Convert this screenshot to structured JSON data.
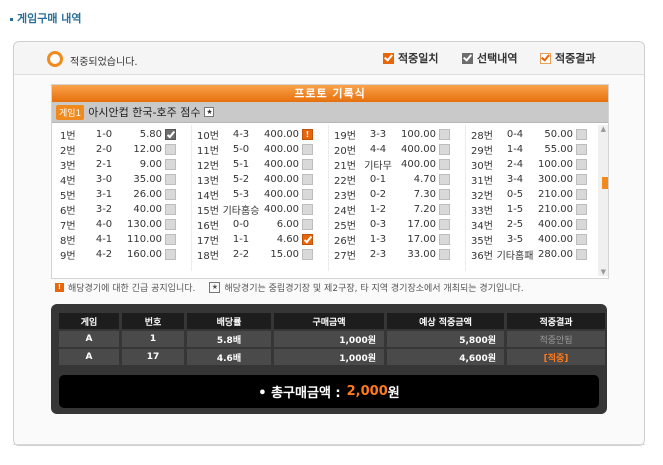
{
  "page": {
    "title": "게임구매 내역"
  },
  "status": {
    "text": "적중되었습니다."
  },
  "legend": [
    {
      "label": "적중일치",
      "style": "orange"
    },
    {
      "label": "선택내역",
      "style": "gray"
    },
    {
      "label": "적중결과",
      "style": "outline"
    }
  ],
  "proto": {
    "title": "프로토 기록식",
    "game_tag": "게임1",
    "game_name": "아시안컵 한국-호주 점수",
    "info_icon": "★"
  },
  "columns": [
    {
      "rows": [
        {
          "no": "1번",
          "res": "1-0",
          "odd": "5.80",
          "mark": "gray"
        },
        {
          "no": "2번",
          "res": "2-0",
          "odd": "12.00",
          "mark": ""
        },
        {
          "no": "3번",
          "res": "2-1",
          "odd": "9.00",
          "mark": ""
        },
        {
          "no": "4번",
          "res": "3-0",
          "odd": "35.00",
          "mark": ""
        },
        {
          "no": "5번",
          "res": "3-1",
          "odd": "26.00",
          "mark": ""
        },
        {
          "no": "6번",
          "res": "3-2",
          "odd": "40.00",
          "mark": ""
        },
        {
          "no": "7번",
          "res": "4-0",
          "odd": "130.00",
          "mark": ""
        },
        {
          "no": "8번",
          "res": "4-1",
          "odd": "110.00",
          "mark": ""
        },
        {
          "no": "9번",
          "res": "4-2",
          "odd": "160.00",
          "mark": ""
        }
      ]
    },
    {
      "rows": [
        {
          "no": "10번",
          "res": "4-3",
          "odd": "400.00",
          "mark": "excl"
        },
        {
          "no": "11번",
          "res": "5-0",
          "odd": "400.00",
          "mark": ""
        },
        {
          "no": "12번",
          "res": "5-1",
          "odd": "400.00",
          "mark": ""
        },
        {
          "no": "13번",
          "res": "5-2",
          "odd": "400.00",
          "mark": ""
        },
        {
          "no": "14번",
          "res": "5-3",
          "odd": "400.00",
          "mark": ""
        },
        {
          "no": "15번",
          "res": "기타홈승",
          "odd": "400.00",
          "mark": ""
        },
        {
          "no": "16번",
          "res": "0-0",
          "odd": "6.00",
          "mark": ""
        },
        {
          "no": "17번",
          "res": "1-1",
          "odd": "4.60",
          "mark": "orange"
        },
        {
          "no": "18번",
          "res": "2-2",
          "odd": "15.00",
          "mark": ""
        }
      ]
    },
    {
      "rows": [
        {
          "no": "19번",
          "res": "3-3",
          "odd": "100.00",
          "mark": ""
        },
        {
          "no": "20번",
          "res": "4-4",
          "odd": "400.00",
          "mark": ""
        },
        {
          "no": "21번",
          "res": "기타무",
          "odd": "400.00",
          "mark": ""
        },
        {
          "no": "22번",
          "res": "0-1",
          "odd": "4.70",
          "mark": ""
        },
        {
          "no": "23번",
          "res": "0-2",
          "odd": "7.30",
          "mark": ""
        },
        {
          "no": "24번",
          "res": "1-2",
          "odd": "7.20",
          "mark": ""
        },
        {
          "no": "25번",
          "res": "0-3",
          "odd": "17.00",
          "mark": ""
        },
        {
          "no": "26번",
          "res": "1-3",
          "odd": "17.00",
          "mark": ""
        },
        {
          "no": "27번",
          "res": "2-3",
          "odd": "33.00",
          "mark": ""
        }
      ]
    },
    {
      "rows": [
        {
          "no": "28번",
          "res": "0-4",
          "odd": "50.00",
          "mark": ""
        },
        {
          "no": "29번",
          "res": "1-4",
          "odd": "55.00",
          "mark": ""
        },
        {
          "no": "30번",
          "res": "2-4",
          "odd": "100.00",
          "mark": ""
        },
        {
          "no": "31번",
          "res": "3-4",
          "odd": "300.00",
          "mark": ""
        },
        {
          "no": "32번",
          "res": "0-5",
          "odd": "210.00",
          "mark": ""
        },
        {
          "no": "33번",
          "res": "1-5",
          "odd": "210.00",
          "mark": ""
        },
        {
          "no": "34번",
          "res": "2-5",
          "odd": "400.00",
          "mark": ""
        },
        {
          "no": "35번",
          "res": "3-5",
          "odd": "400.00",
          "mark": ""
        },
        {
          "no": "36번",
          "res": "기타홈패",
          "odd": "280.00",
          "mark": ""
        }
      ]
    }
  ],
  "notice": {
    "urgent": "해당경기에 대한 긴급 공지입니다.",
    "neutral": "해당경기는 중립경기장 및 제2구장, 타 지역 경기장소에서 개최되는 경기입니다.",
    "urgent_icon": "!",
    "neutral_icon": "★"
  },
  "summary": {
    "headers": [
      "게임",
      "번호",
      "배당률",
      "구매금액",
      "예상 적중금액",
      "적중결과"
    ],
    "rows": [
      {
        "game": "A",
        "no": "1",
        "odds": "5.8배",
        "amount": "1,000원",
        "expected": "5,800원",
        "result": "적중안됨",
        "result_style": "miss"
      },
      {
        "game": "A",
        "no": "17",
        "odds": "4.6배",
        "amount": "1,000원",
        "expected": "4,600원",
        "result": "[적중]",
        "result_style": "hit"
      }
    ],
    "total_label": "• 총구매금액 :",
    "total_value": "2,000",
    "total_unit": "원"
  },
  "colors": {
    "accent": "#e8660a",
    "dark": "#363636"
  }
}
